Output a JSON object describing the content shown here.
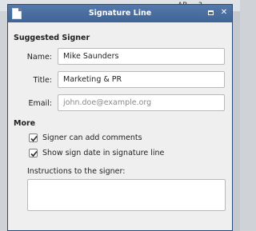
{
  "window": {
    "title": "Signature Line"
  },
  "suggested_signer": {
    "heading": "Suggested Signer",
    "name_label": "Name:",
    "name_value": "Mike Saunders",
    "title_label": "Title:",
    "title_value": "Marketing & PR",
    "email_label": "Email:",
    "email_value": "",
    "email_placeholder": "john.doe@example.org"
  },
  "more": {
    "heading": "More",
    "options": [
      {
        "label": "Signer can add comments",
        "checked": true
      },
      {
        "label": "Show sign date in signature line",
        "checked": true
      }
    ],
    "instructions_label": "Instructions to the signer:",
    "instructions_value": ""
  },
  "background_toolbar": {
    "visible_text": [
      "AB",
      "?"
    ]
  }
}
